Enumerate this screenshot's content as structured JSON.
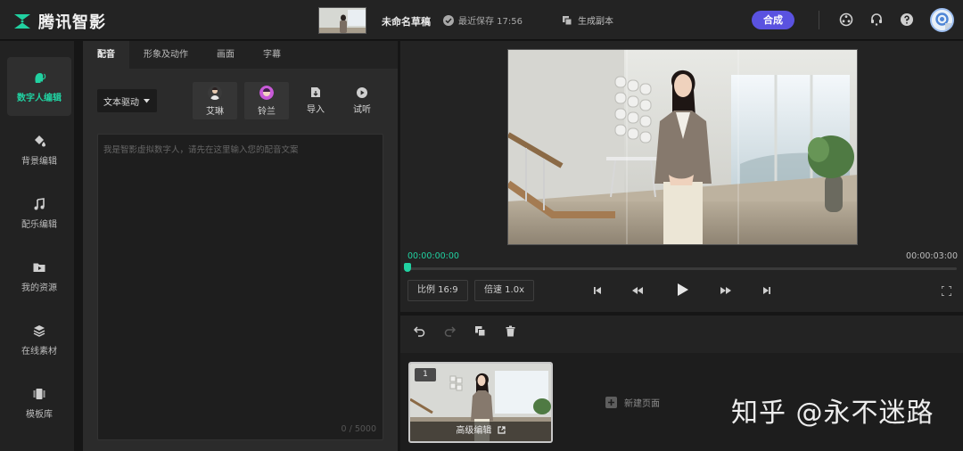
{
  "app": {
    "name": "腾讯智影"
  },
  "header": {
    "draft_title": "未命名草稿",
    "save_status": "最近保存 17:56",
    "copy_label": "生成副本",
    "compose_label": "合成",
    "icons": [
      "share-icon",
      "support-icon",
      "help-icon"
    ]
  },
  "sidebar": {
    "items": [
      {
        "label": "数字人编辑",
        "icon": "digital-human-icon",
        "active": true
      },
      {
        "label": "背景编辑",
        "icon": "paint-bucket-icon"
      },
      {
        "label": "配乐编辑",
        "icon": "music-note-icon"
      },
      {
        "label": "我的资源",
        "icon": "folder-play-icon"
      },
      {
        "label": "在线素材",
        "icon": "layers-icon"
      },
      {
        "label": "模板库",
        "icon": "template-icon"
      }
    ]
  },
  "panel": {
    "tabs": [
      {
        "label": "配音",
        "active": true
      },
      {
        "label": "形象及动作"
      },
      {
        "label": "画面"
      },
      {
        "label": "字幕"
      }
    ],
    "drive_select": "文本驱动",
    "voices": [
      {
        "label": "艾琳"
      },
      {
        "label": "铃兰"
      }
    ],
    "actions": {
      "import": "导入",
      "listen": "试听"
    },
    "script_placeholder": "我是智影虚拟数字人，请先在这里输入您的配音文案",
    "counter": "0 / 5000"
  },
  "player": {
    "time_current": "00:00:00:00",
    "time_total": "00:00:03:00",
    "progress": 0,
    "ratio_label": "比例 16:9",
    "speed_label": "倍速 1.0x"
  },
  "pages": {
    "items": [
      {
        "number": "1",
        "action": "高级编辑"
      }
    ],
    "new_page_label": "新建页面"
  },
  "watermark": "知乎 @永不迷路",
  "colors": {
    "accent": "#21d1a1",
    "primary": "#5a52e0",
    "background": "#161616"
  }
}
